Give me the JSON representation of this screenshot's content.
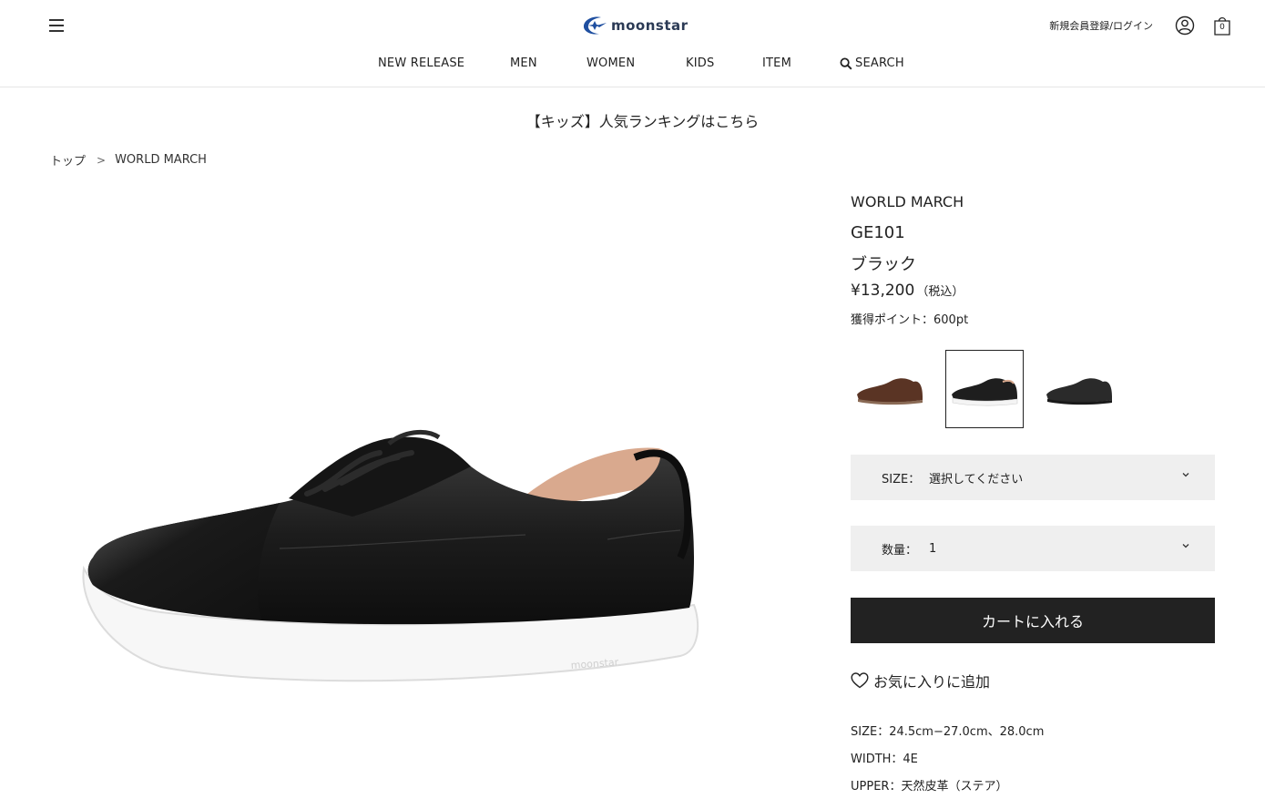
{
  "header": {
    "logo_text": "moonstar",
    "login_label": "新規会員登録/ログイン",
    "cart_count": "0",
    "icons": {
      "menu": "hamburger-icon",
      "account": "user-icon",
      "cart": "shopping-bag-icon",
      "search": "search-icon"
    }
  },
  "nav": {
    "items": [
      {
        "label": "NEW RELEASE"
      },
      {
        "label": "MEN"
      },
      {
        "label": "WOMEN"
      },
      {
        "label": "KIDS"
      },
      {
        "label": "ITEM"
      },
      {
        "label": "SEARCH"
      }
    ]
  },
  "banner": {
    "text": "【キッズ】人気ランキングはこちら"
  },
  "breadcrumb": {
    "home": "トップ",
    "separator": ">",
    "current": "WORLD MARCH"
  },
  "product": {
    "brand": "WORLD MARCH",
    "model": "GE101",
    "color": "ブラック",
    "price": "¥13,200",
    "tax_label": "（税込）",
    "points": "獲得ポイント：600pt",
    "variants": [
      {
        "name": "brown",
        "selected": false,
        "color": "#5a3424"
      },
      {
        "name": "black-white-sole",
        "selected": true,
        "color": "#1e1e1e"
      },
      {
        "name": "black",
        "selected": false,
        "color": "#2a2a2a"
      }
    ],
    "size_select": {
      "label": "SIZE：",
      "value": "選択してください"
    },
    "qty_select": {
      "label": "数量：",
      "value": "1"
    },
    "cart_button": "カートに入れる",
    "favorite": "お気に入りに追加",
    "specs": [
      "SIZE：24.5cm−27.0cm、28.0cm",
      "WIDTH：4E",
      "UPPER：天然皮革（ステア）"
    ]
  },
  "colors": {
    "accent": "#222222",
    "select_bg": "#efefef",
    "logo_blue": "#1f4fa0"
  }
}
